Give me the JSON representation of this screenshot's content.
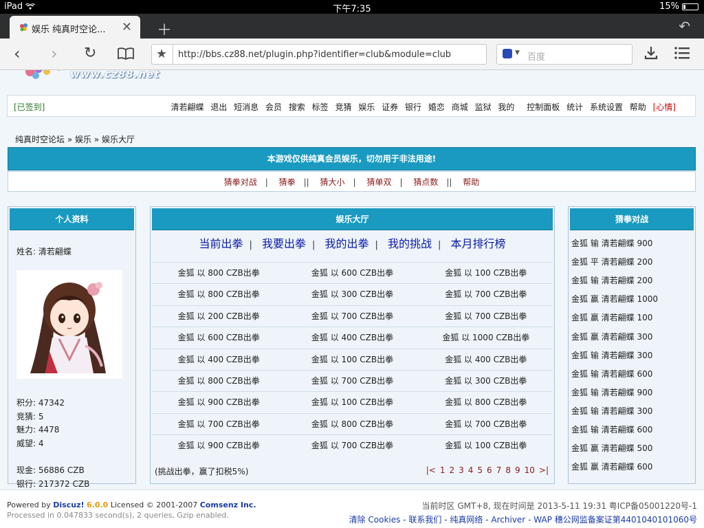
{
  "status_bar": {
    "device": "iPad",
    "time": "下午7:35",
    "battery": "15%",
    "battery_level": 0.15
  },
  "browser": {
    "tab_title": "娱乐 纯真时空论...",
    "url": "http://bbs.cz88.net/plugin.php?identifier=club&module=club",
    "search_placeholder": "百度"
  },
  "site": {
    "logo_text": "www.cz88.net",
    "signin": "[已签到]",
    "nav": [
      "清若翩蝶",
      "退出",
      "短消息",
      "会员",
      "搜索",
      "标签",
      "竞猜",
      "娱乐",
      "证券",
      "银行",
      "婚恋",
      "商城",
      "监狱",
      "我的"
    ],
    "nav_right": [
      "控制面板",
      "统计",
      "系统设置",
      "帮助"
    ],
    "nav_mood": "[心情]",
    "breadcrumb": [
      "纯真时空论坛",
      "»",
      "娱乐",
      "»",
      "娱乐大厅"
    ],
    "warning": "本游戏仅供纯真会员娱乐，切勿用于非法用途!",
    "game_links": [
      "猜拳对战",
      "猜拳",
      "猜大小",
      "猜单双",
      "猜点数",
      "帮助"
    ]
  },
  "profile": {
    "title": "个人资料",
    "name_label": "姓名:",
    "name": "清若翩蝶",
    "stats": [
      {
        "label": "积分:",
        "value": "47342"
      },
      {
        "label": "竞猜:",
        "value": "5"
      },
      {
        "label": "魅力:",
        "value": "4478"
      },
      {
        "label": "威望:",
        "value": "4"
      },
      {
        "label": "现金:",
        "value": "56886 CZB"
      },
      {
        "label": "银行:",
        "value": "217372 CZB"
      }
    ]
  },
  "hall": {
    "title": "娱乐大厅",
    "tabs": [
      "当前出拳",
      "我要出拳",
      "我的出拳",
      "我的挑战",
      "本月排行榜"
    ],
    "rows": [
      [
        "金狐 以 800 CZB出拳",
        "金狐 以 600 CZB出拳",
        "金狐 以 100 CZB出拳"
      ],
      [
        "金狐 以 800 CZB出拳",
        "金狐 以 300 CZB出拳",
        "金狐 以 700 CZB出拳"
      ],
      [
        "金狐 以 200 CZB出拳",
        "金狐 以 700 CZB出拳",
        "金狐 以 700 CZB出拳"
      ],
      [
        "金狐 以 600 CZB出拳",
        "金狐 以 400 CZB出拳",
        "金狐 以 1000 CZB出拳"
      ],
      [
        "金狐 以 400 CZB出拳",
        "金狐 以 100 CZB出拳",
        "金狐 以 400 CZB出拳"
      ],
      [
        "金狐 以 800 CZB出拳",
        "金狐 以 700 CZB出拳",
        "金狐 以 300 CZB出拳"
      ],
      [
        "金狐 以 900 CZB出拳",
        "金狐 以 100 CZB出拳",
        "金狐 以 800 CZB出拳"
      ],
      [
        "金狐 以 700 CZB出拳",
        "金狐 以 800 CZB出拳",
        "金狐 以 700 CZB出拳"
      ],
      [
        "金狐 以 900 CZB出拳",
        "金狐 以 700 CZB出拳",
        "金狐 以 100 CZB出拳"
      ]
    ],
    "footnote": "(挑战出拳，赢了扣税5%)",
    "pager": [
      "|<",
      "1",
      "2",
      "3",
      "4",
      "5",
      "6",
      "7",
      "8",
      "9",
      "10",
      ">|"
    ]
  },
  "battle": {
    "title": "猜拳对战",
    "items": [
      "金狐 输 清若翩蝶 900",
      "金狐 平 清若翩蝶 200",
      "金狐 输 清若翩蝶 200",
      "金狐 赢 清若翩蝶 1000",
      "金狐 赢 清若翩蝶 100",
      "金狐 赢 清若翩蝶 300",
      "金狐 输 清若翩蝶 300",
      "金狐 输 清若翩蝶 600",
      "金狐 输 清若翩蝶 900",
      "金狐 输 清若翩蝶 300",
      "金狐 输 清若翩蝶 600",
      "金狐 赢 清若翩蝶 500",
      "金狐 赢 清若翩蝶 600"
    ]
  },
  "footer": {
    "powered_prefix": "Powered by ",
    "product": "Discuz!",
    "version": "6.0.0",
    "license": " Licensed © 2001-2007 ",
    "company": "Comsenz Inc.",
    "processed": "Processed in 0.047833 second(s), 2 queries, Gzip enabled.",
    "timezone": "当前时区 GMT+8, 现在时间是 2013-5-11 19:31 粤ICP备05001220号-1",
    "links": [
      "清除 Cookies",
      "-",
      "联系我们",
      "-",
      "纯真网络",
      "-",
      "Archiver",
      "-",
      "WAP",
      "穗公网监备案证第4401040101060号"
    ]
  },
  "colors": {
    "accent": "#1a9ac0",
    "link_dark_red": "#8a1a1a",
    "tab_link_blue": "#0a1aa8",
    "page_bg": "#f1f6fa"
  }
}
